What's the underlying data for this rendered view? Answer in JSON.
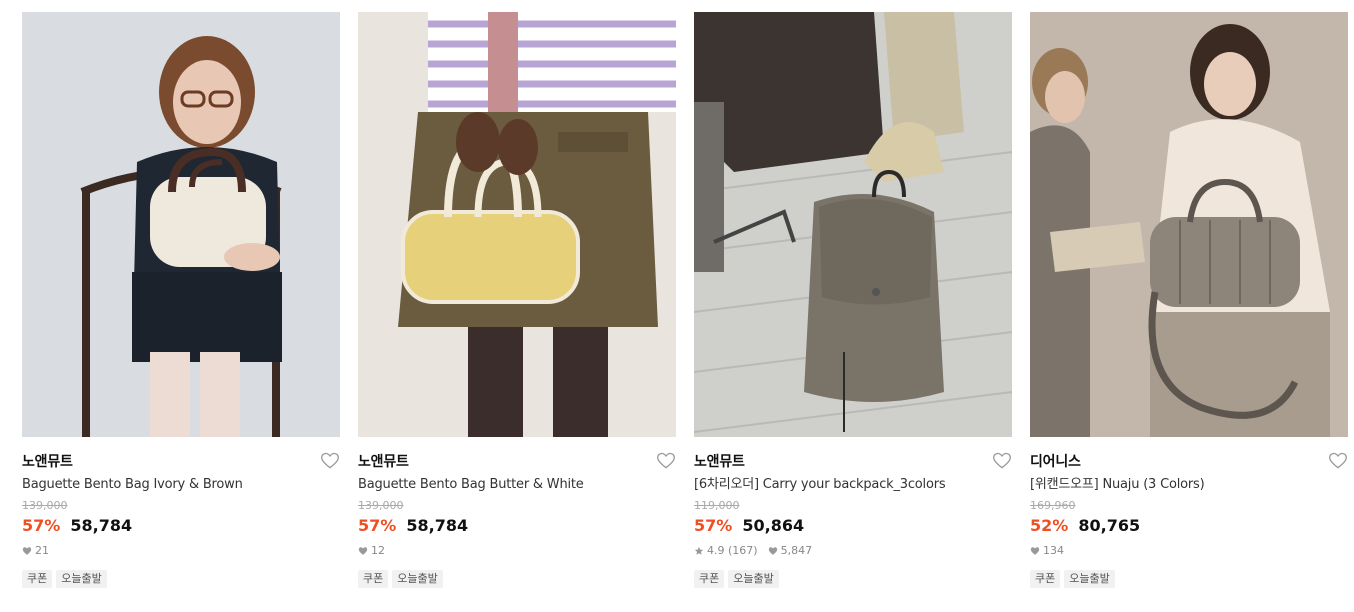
{
  "products": [
    {
      "brand": "노앤뮤트",
      "name": "Baguette Bento Bag Ivory & Brown",
      "original_price": "139,000",
      "discount": "57%",
      "price": "58,784",
      "likes": "21",
      "tags": [
        "쿠폰",
        "오늘출발"
      ],
      "photo": {
        "bg": "#d9dde1",
        "bag_color": "#efe9dd",
        "handle_color": "#4a2e26"
      }
    },
    {
      "brand": "노앤뮤트",
      "name": "Baguette Bento Bag Butter & White",
      "original_price": "139,000",
      "discount": "57%",
      "price": "58,784",
      "likes": "12",
      "tags": [
        "쿠폰",
        "오늘출발"
      ],
      "photo": {
        "bg": "#e9e5de",
        "bag_color": "#e6d07a",
        "handle_color": "#f2ead8"
      }
    },
    {
      "brand": "노앤뮤트",
      "name": "[6차리오더] Carry your backpack_3colors",
      "original_price": "119,000",
      "discount": "57%",
      "price": "50,864",
      "rating": "4.9 (167)",
      "likes": "5,847",
      "tags": [
        "쿠폰",
        "오늘출발"
      ],
      "photo": {
        "bg": "#cfcfcc",
        "bag_color": "#7a7468",
        "handle_color": "#2a2a2a"
      }
    },
    {
      "brand": "디어니스",
      "name": "[위캔드오프] Nuaju (3 Colors)",
      "original_price": "169,960",
      "discount": "52%",
      "price": "80,765",
      "likes": "134",
      "tags": [
        "쿠폰",
        "오늘출발"
      ],
      "photo": {
        "bg": "#bdb2a4",
        "bag_color": "#8e857a",
        "handle_color": "#5d564e"
      }
    }
  ],
  "icons": {
    "like": "heart-outline-icon",
    "likes_count": "heart-filled-icon",
    "rating": "star-icon"
  },
  "colors": {
    "discount": "#f04f22",
    "text": "#111111",
    "muted": "#888888"
  }
}
